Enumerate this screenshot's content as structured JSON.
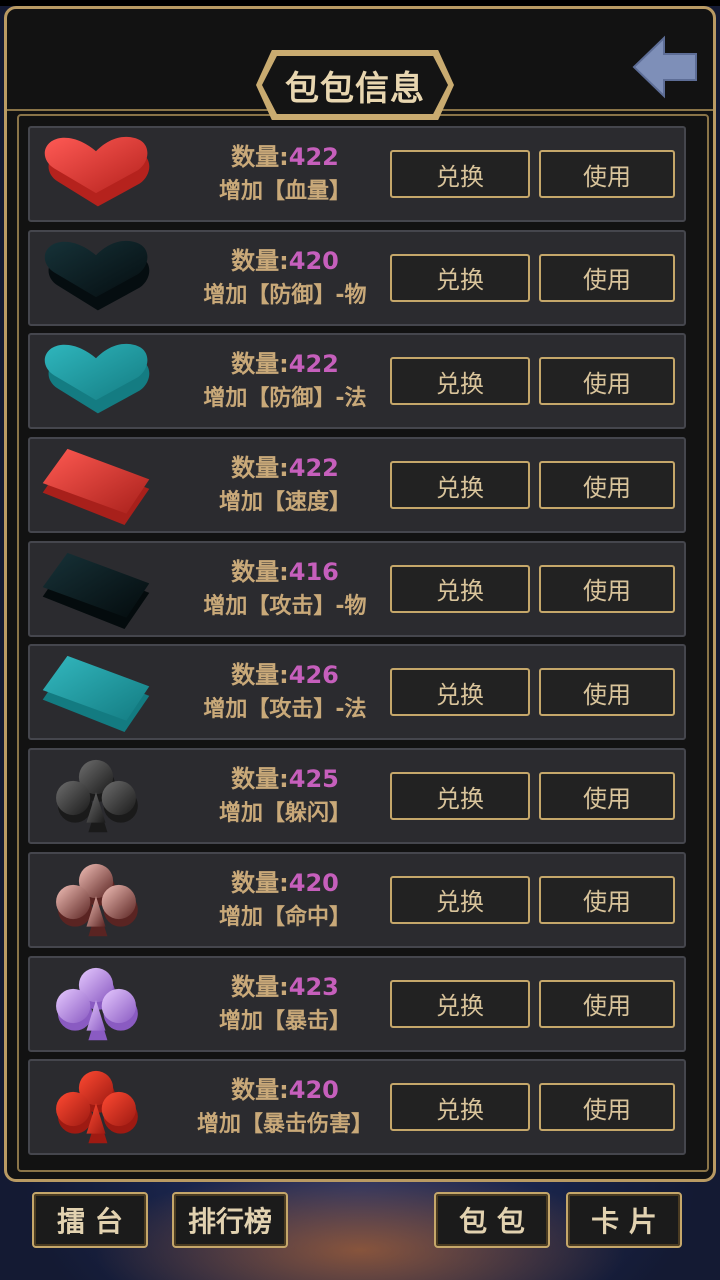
{
  "header": {
    "title": "包包信息",
    "back_icon": "back-arrow-icon"
  },
  "qty_label": "数量:",
  "buttons": {
    "exchange": "兑换",
    "use": "使用"
  },
  "items": [
    {
      "icon": "heart-red-icon",
      "quantity": "422",
      "effect": "增加【血量】"
    },
    {
      "icon": "heart-black-icon",
      "quantity": "420",
      "effect": "增加【防御】-物"
    },
    {
      "icon": "heart-teal-icon",
      "quantity": "422",
      "effect": "增加【防御】-法"
    },
    {
      "icon": "diamond-red-icon",
      "quantity": "422",
      "effect": "增加【速度】"
    },
    {
      "icon": "diamond-black-icon",
      "quantity": "416",
      "effect": "增加【攻击】-物"
    },
    {
      "icon": "diamond-teal-icon",
      "quantity": "426",
      "effect": "增加【攻击】-法"
    },
    {
      "icon": "club-gray-icon",
      "quantity": "425",
      "effect": "增加【躲闪】"
    },
    {
      "icon": "club-pink-icon",
      "quantity": "420",
      "effect": "增加【命中】"
    },
    {
      "icon": "club-lilac-icon",
      "quantity": "423",
      "effect": "增加【暴击】"
    },
    {
      "icon": "club-red-icon",
      "quantity": "420",
      "effect": "增加【暴击伤害】"
    }
  ],
  "nav": {
    "arena": "擂 台",
    "ranking": "排行榜",
    "bag": "包 包",
    "cards": "卡 片"
  },
  "colors": {
    "frame_gold": "#c5a76a",
    "qty_value": "#c65fbc",
    "label_gold": "#c9a979",
    "row_bg": "#2b2b2f"
  }
}
